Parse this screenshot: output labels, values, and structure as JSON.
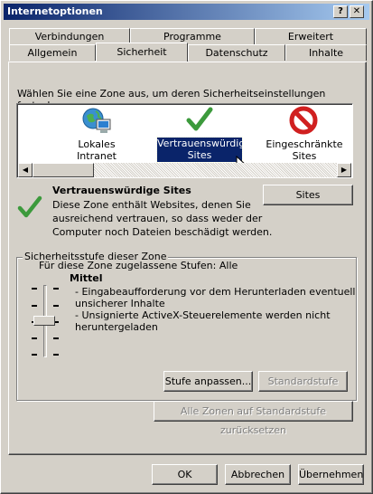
{
  "window": {
    "title": "Internetoptionen",
    "help_glyph": "?",
    "close_glyph": "✕"
  },
  "tabs": {
    "row_back": [
      {
        "label": "Verbindungen"
      },
      {
        "label": "Programme"
      },
      {
        "label": "Erweitert"
      }
    ],
    "row_front": [
      {
        "label": "Allgemein"
      },
      {
        "label": "Sicherheit"
      },
      {
        "label": "Datenschutz"
      },
      {
        "label": "Inhalte"
      }
    ],
    "selected": "Sicherheit"
  },
  "zones": {
    "instruction": "Wählen Sie eine Zone aus, um deren Sicherheitseinstellungen festzulegen.",
    "items": [
      {
        "label": "Lokales Intranet",
        "icon": "globe-computer-icon"
      },
      {
        "label_line1": "Vertrauenswürdige",
        "label_line2": "Sites",
        "icon": "checkmark-icon"
      },
      {
        "label": "Eingeschränkte Sites",
        "icon": "prohibited-icon"
      }
    ],
    "selected_zone": "Vertrauenswürdige Sites"
  },
  "zone_info": {
    "title": "Vertrauenswürdige Sites",
    "line1": "Diese Zone enthält Websites, denen Sie",
    "line2": "ausreichend vertrauen, so dass weder der",
    "line3": "Computer noch Dateien beschädigt werden.",
    "sites_button": "Sites"
  },
  "security_level": {
    "group_title": "Sicherheitsstufe dieser Zone",
    "allowed_levels": "Für diese Zone zugelassene Stufen: Alle",
    "level_name": "Mittel",
    "bullet1_line1": "- Eingabeaufforderung vor dem Herunterladen eventuell",
    "bullet1_line2": "unsicherer Inhalte",
    "bullet2_line1": "- Unsignierte ActiveX-Steuerelemente werden nicht",
    "bullet2_line2": "heruntergeladen",
    "slider_level": "Mittel",
    "custom_button": "Stufe anpassen...",
    "default_button": "Standardstufe"
  },
  "reset_all_button": "Alle Zonen auf Standardstufe zurücksetzen",
  "footer": {
    "ok": "OK",
    "cancel": "Abbrechen",
    "apply": "Übernehmen"
  },
  "colors": {
    "titlebar": "#0a246a",
    "face": "#d4d0c8",
    "selection": "#0a246a",
    "check_green": "#3c9a3c",
    "prohibit_red": "#d02020"
  }
}
